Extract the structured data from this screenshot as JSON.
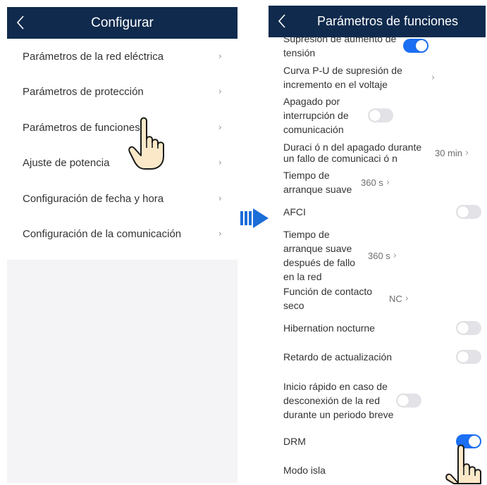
{
  "left": {
    "title": "Configurar",
    "items": [
      {
        "label": "Parámetros de la red eléctrica"
      },
      {
        "label": "Parámetros de protección"
      },
      {
        "label": "Parámetros de funciones"
      },
      {
        "label": "Ajuste de potencia"
      },
      {
        "label": "Configuración de fecha y hora"
      },
      {
        "label": "Configuración de la comunicación"
      }
    ]
  },
  "right": {
    "title": "Parámetros de funciones",
    "rows": [
      {
        "label": "Supresión de aumento de tensión",
        "toggle": "on"
      },
      {
        "label": "Curva P-U de supresión de incremento en el voltaje"
      },
      {
        "label": "Apagado por interrupción de comunicación",
        "toggle": "off"
      },
      {
        "label": "Duraci ó n del apagado durante un fallo de comunicaci ó n",
        "value": "30 min"
      },
      {
        "label": "Tiempo de arranque suave",
        "value": "360 s"
      },
      {
        "label": "AFCI",
        "toggle": "off"
      },
      {
        "label": "Tiempo de arranque suave después de fallo en la red",
        "value": "360 s"
      },
      {
        "label": "Función de contacto seco",
        "value": "NC"
      },
      {
        "label": "Hibernation nocturne",
        "toggle": "off"
      },
      {
        "label": "Retardo de actualización",
        "toggle": "off"
      },
      {
        "label": "Inicio rápido en caso de desconexión de la red durante un periodo breve",
        "toggle": "off"
      },
      {
        "label": "DRM",
        "toggle": "on"
      },
      {
        "label": "Modo isla"
      }
    ]
  },
  "icons": {
    "back": "chevron-left-icon",
    "chevron": "chevron-right-icon",
    "arrow": "double-arrow-right-icon",
    "pointer": "pointing-hand-icon"
  },
  "colors": {
    "header": "#0f2a4d",
    "toggle_on": "#1b6ff3",
    "toggle_off": "#e3e3e7",
    "arrow": "#1b6dd8"
  },
  "chevron_glyph": "›"
}
